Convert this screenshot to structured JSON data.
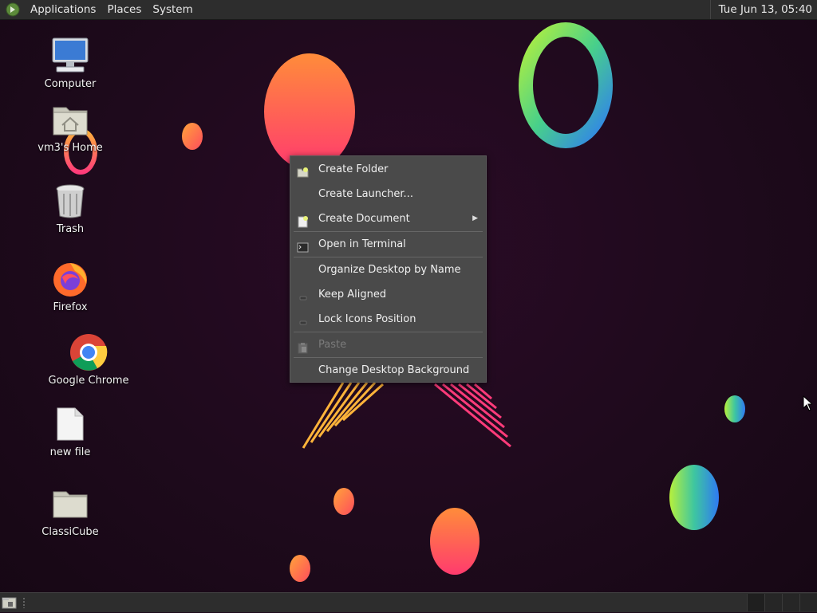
{
  "top_panel": {
    "menus": [
      "Applications",
      "Places",
      "System"
    ],
    "clock": "Tue Jun 13, 05:40"
  },
  "desktop_icons": [
    {
      "label": "Computer",
      "icon": "computer-icon"
    },
    {
      "label": "vm3's Home",
      "icon": "home-folder-icon"
    },
    {
      "label": "Trash",
      "icon": "trash-icon"
    },
    {
      "label": "Firefox",
      "icon": "firefox-icon"
    },
    {
      "label": "Google Chrome",
      "icon": "chrome-icon"
    },
    {
      "label": "new file",
      "icon": "file-icon"
    },
    {
      "label": "ClassiCube",
      "icon": "folder-icon"
    }
  ],
  "context_menu": {
    "items": [
      {
        "label": "Create Folder",
        "icon": "new-folder-icon"
      },
      {
        "label": "Create Launcher...",
        "icon": ""
      },
      {
        "label": "Create Document",
        "icon": "new-document-icon",
        "submenu": true
      },
      {
        "label": "Open in Terminal",
        "icon": "terminal-icon"
      },
      {
        "label": "Organize Desktop by Name",
        "icon": ""
      },
      {
        "label": "Keep Aligned",
        "icon": "checkbox-icon"
      },
      {
        "label": "Lock Icons Position",
        "icon": "checkbox-icon"
      },
      {
        "label": "Paste",
        "icon": "paste-icon",
        "disabled": true
      },
      {
        "label": "Change Desktop Background",
        "icon": ""
      }
    ]
  },
  "colors": {
    "panel": "#2d2d2d",
    "menu_bg": "#4a4a4a",
    "desktop_bg": "#1e0a1c"
  }
}
